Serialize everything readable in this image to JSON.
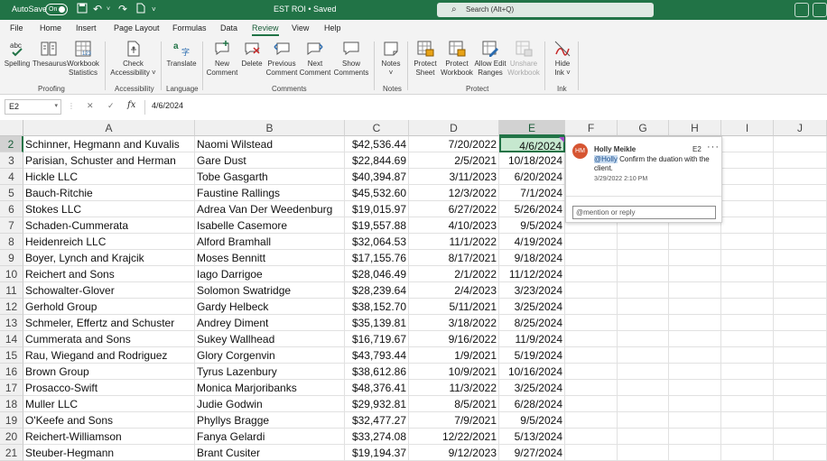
{
  "titlebar": {
    "autosave_label": "AutoSave",
    "autosave_state": "On",
    "doc_title": "EST ROI • Saved",
    "search_placeholder": "Search (Alt+Q)"
  },
  "ribbon_tabs": [
    "File",
    "Home",
    "Insert",
    "Page Layout",
    "Formulas",
    "Data",
    "Review",
    "View",
    "Help"
  ],
  "active_tab": "Review",
  "ribbon": {
    "buttons": {
      "spelling": "Spelling",
      "thesaurus": "Thesaurus",
      "workbook_statistics": [
        "Workbook",
        "Statistics"
      ],
      "check_accessibility": [
        "Check",
        "Accessibility ˅"
      ],
      "translate": "Translate",
      "new_comment": [
        "New",
        "Comment"
      ],
      "delete": "Delete",
      "previous_comment": [
        "Previous",
        "Comment"
      ],
      "next_comment": [
        "Next",
        "Comment"
      ],
      "show_comments": [
        "Show",
        "Comments"
      ],
      "notes": [
        "Notes",
        "˅"
      ],
      "protect_sheet": [
        "Protect",
        "Sheet"
      ],
      "protect_workbook": [
        "Protect",
        "Workbook"
      ],
      "allow_edit_ranges": [
        "Allow Edit",
        "Ranges"
      ],
      "unshare_workbook": [
        "Unshare",
        "Workbook"
      ],
      "hide_ink": [
        "Hide",
        "Ink ˅"
      ]
    },
    "groups": {
      "proofing": "Proofing",
      "accessibility": "Accessibility",
      "language": "Language",
      "comments": "Comments",
      "notes": "Notes",
      "protect": "Protect",
      "ink": "Ink"
    },
    "icons": [
      "spelling-icon",
      "thesaurus-icon",
      "workbook-statistics-icon",
      "accessibility-icon",
      "translate-icon",
      "new-comment-icon",
      "delete-comment-icon",
      "previous-comment-icon",
      "next-comment-icon",
      "show-comments-icon",
      "notes-icon",
      "protect-sheet-icon",
      "protect-workbook-icon",
      "allow-edit-ranges-icon",
      "unshare-workbook-icon",
      "hide-ink-icon"
    ]
  },
  "formula_bar": {
    "name_box": "E2",
    "fx_label": "fx",
    "value": "4/6/2024"
  },
  "columns": [
    "A",
    "B",
    "C",
    "D",
    "E",
    "F",
    "G",
    "H",
    "I",
    "J"
  ],
  "selected_column": "E",
  "selected_row": "2",
  "rows": [
    {
      "num": "2",
      "a": "Schinner, Hegmann and Kuvalis",
      "b": "Naomi Wilstead",
      "c": "$42,536.44",
      "d": "7/20/2022",
      "e": "4/6/2024"
    },
    {
      "num": "3",
      "a": "Parisian, Schuster and Herman",
      "b": "Gare Dust",
      "c": "$22,844.69",
      "d": "2/5/2021",
      "e": "10/18/2024"
    },
    {
      "num": "4",
      "a": "Hickle LLC",
      "b": "Tobe Gasgarth",
      "c": "$40,394.87",
      "d": "3/11/2023",
      "e": "6/20/2024"
    },
    {
      "num": "5",
      "a": "Bauch-Ritchie",
      "b": "Faustine Rallings",
      "c": "$45,532.60",
      "d": "12/3/2022",
      "e": "7/1/2024"
    },
    {
      "num": "6",
      "a": "Stokes LLC",
      "b": "Adrea Van Der Weedenburg",
      "c": "$19,015.97",
      "d": "6/27/2022",
      "e": "5/26/2024"
    },
    {
      "num": "7",
      "a": "Schaden-Cummerata",
      "b": "Isabelle Casemore",
      "c": "$19,557.88",
      "d": "4/10/2023",
      "e": "9/5/2024"
    },
    {
      "num": "8",
      "a": "Heidenreich LLC",
      "b": "Alford Bramhall",
      "c": "$32,064.53",
      "d": "11/1/2022",
      "e": "4/19/2024"
    },
    {
      "num": "9",
      "a": "Boyer, Lynch and Krajcik",
      "b": "Moses Bennitt",
      "c": "$17,155.76",
      "d": "8/17/2021",
      "e": "9/18/2024"
    },
    {
      "num": "10",
      "a": "Reichert and Sons",
      "b": "Iago Darrigoe",
      "c": "$28,046.49",
      "d": "2/1/2022",
      "e": "11/12/2024"
    },
    {
      "num": "11",
      "a": "Schowalter-Glover",
      "b": "Solomon Swatridge",
      "c": "$28,239.64",
      "d": "2/4/2023",
      "e": "3/23/2024"
    },
    {
      "num": "12",
      "a": "Gerhold Group",
      "b": "Gardy Helbeck",
      "c": "$38,152.70",
      "d": "5/11/2021",
      "e": "3/25/2024"
    },
    {
      "num": "13",
      "a": "Schmeler, Effertz and Schuster",
      "b": "Andrey Diment",
      "c": "$35,139.81",
      "d": "3/18/2022",
      "e": "8/25/2024"
    },
    {
      "num": "14",
      "a": "Cummerata and Sons",
      "b": "Sukey Wallhead",
      "c": "$16,719.67",
      "d": "9/16/2022",
      "e": "11/9/2024"
    },
    {
      "num": "15",
      "a": "Rau, Wiegand and Rodriguez",
      "b": "Glory Corgenvin",
      "c": "$43,793.44",
      "d": "1/9/2021",
      "e": "5/19/2024"
    },
    {
      "num": "16",
      "a": "Brown Group",
      "b": "Tyrus Lazenbury",
      "c": "$38,612.86",
      "d": "10/9/2021",
      "e": "10/16/2024"
    },
    {
      "num": "17",
      "a": "Prosacco-Swift",
      "b": "Monica Marjoribanks",
      "c": "$48,376.41",
      "d": "11/3/2022",
      "e": "3/25/2024"
    },
    {
      "num": "18",
      "a": "Muller LLC",
      "b": "Judie Godwin",
      "c": "$29,932.81",
      "d": "8/5/2021",
      "e": "6/28/2024"
    },
    {
      "num": "19",
      "a": "O'Keefe and Sons",
      "b": "Phyllys Bragge",
      "c": "$32,477.27",
      "d": "7/9/2021",
      "e": "9/5/2024"
    },
    {
      "num": "20",
      "a": "Reichert-Williamson",
      "b": "Fanya Gelardi",
      "c": "$33,274.08",
      "d": "12/22/2021",
      "e": "5/13/2024"
    },
    {
      "num": "21",
      "a": "Steuber-Hegmann",
      "b": "Brant Cusiter",
      "c": "$19,194.37",
      "d": "9/12/2023",
      "e": "9/27/2024"
    }
  ],
  "comment": {
    "initials": "HM",
    "author": "Holly Meikle",
    "cell_ref": "E2",
    "more": "···",
    "mention": "@Holly",
    "text": " Confirm the duation with the client.",
    "timestamp": "3/29/2022 2:10 PM",
    "reply_placeholder": "@mention or reply"
  },
  "colors": {
    "brand": "#217346",
    "active_cell_fill": "#c6e8cf",
    "comment_marker": "#a64ac9",
    "avatar": "#d65532"
  }
}
